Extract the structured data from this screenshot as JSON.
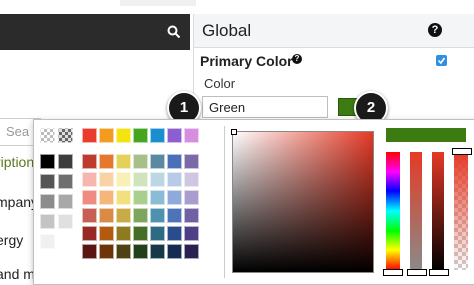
{
  "background": {
    "search_partial": "Sea",
    "rows": [
      "ription",
      "mpany",
      "ergy",
      "and m"
    ]
  },
  "panel": {
    "title": "Global",
    "help_glyph": "?",
    "primary_color_label": "Primary Color",
    "primary_checked": true,
    "color_label": "Color",
    "color_value": "Green",
    "swatch_color": "#3c7a12"
  },
  "callouts": [
    "1",
    "2"
  ],
  "picker": {
    "top_row": [
      "#ea3c2b",
      "#f39a21",
      "#f3e30f",
      "#46a520",
      "#1a8fd0",
      "#8e5dd0",
      "#d78de0"
    ],
    "grays": [
      "#000000",
      "#3d3d3d",
      "#555555",
      "#6f6f6f",
      "#8c8c8c",
      "#a8a8a8",
      "#c4c4c4",
      "#e0e0e0",
      "#f0f0f0",
      "#ffffff"
    ],
    "palette": [
      [
        "#bf3b2d",
        "#e5772f",
        "#e4d15a",
        "#a7c08b",
        "#5a8aa1",
        "#4b6fb8",
        "#7c6aa8"
      ],
      [
        "#f6b6ae",
        "#f9d2a6",
        "#f8f0b4",
        "#cfe3bd",
        "#bcd6e3",
        "#b7cbe8",
        "#cfc6e0"
      ],
      [
        "#ee8c82",
        "#f6b67b",
        "#f2e07e",
        "#a9cf8e",
        "#8bbcd6",
        "#8fa9dc",
        "#a99ccf"
      ],
      [
        "#c85f55",
        "#d98b45",
        "#c9ab45",
        "#7ea55c",
        "#4f91b0",
        "#4e73b8",
        "#7060a4"
      ],
      [
        "#962a24",
        "#b35a12",
        "#8e7a1f",
        "#446e28",
        "#2d6b85",
        "#2a4c8c",
        "#4f3f87"
      ],
      [
        "#5b1610",
        "#6e3408",
        "#4f4212",
        "#22401a",
        "#16394a",
        "#162b52",
        "#2b2150"
      ]
    ],
    "current_color": "#3c7a12",
    "hue_color": "#e53a26"
  }
}
